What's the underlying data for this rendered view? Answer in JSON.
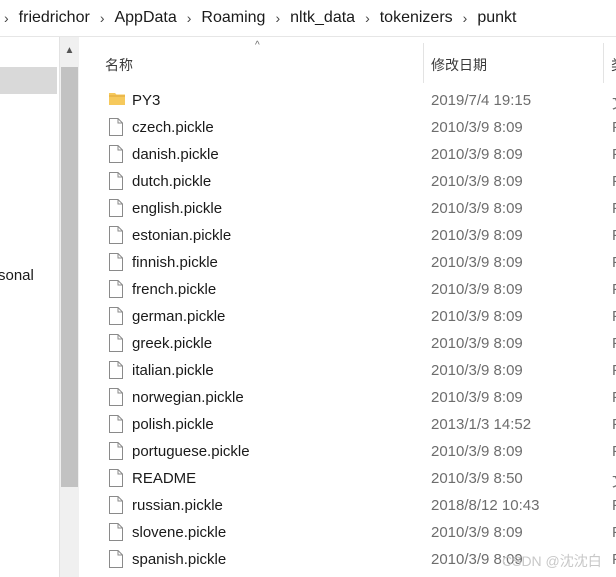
{
  "breadcrumb": {
    "items": [
      "friedrichor",
      "AppData",
      "Roaming",
      "nltk_data",
      "tokenizers",
      "punkt"
    ],
    "separator": "›"
  },
  "nav": {
    "partial_item": "sonal"
  },
  "columns": {
    "name": "名称",
    "date_modified": "修改日期",
    "type_partial": "类"
  },
  "files": [
    {
      "name": "PY3",
      "date": "2019/7/4 19:15",
      "type": "文",
      "icon": "folder-icon"
    },
    {
      "name": "czech.pickle",
      "date": "2010/3/9 8:09",
      "type": "P",
      "icon": "document-icon"
    },
    {
      "name": "danish.pickle",
      "date": "2010/3/9 8:09",
      "type": "P",
      "icon": "document-icon"
    },
    {
      "name": "dutch.pickle",
      "date": "2010/3/9 8:09",
      "type": "P",
      "icon": "document-icon"
    },
    {
      "name": "english.pickle",
      "date": "2010/3/9 8:09",
      "type": "P",
      "icon": "document-icon"
    },
    {
      "name": "estonian.pickle",
      "date": "2010/3/9 8:09",
      "type": "P",
      "icon": "document-icon"
    },
    {
      "name": "finnish.pickle",
      "date": "2010/3/9 8:09",
      "type": "P",
      "icon": "document-icon"
    },
    {
      "name": "french.pickle",
      "date": "2010/3/9 8:09",
      "type": "P",
      "icon": "document-icon"
    },
    {
      "name": "german.pickle",
      "date": "2010/3/9 8:09",
      "type": "P",
      "icon": "document-icon"
    },
    {
      "name": "greek.pickle",
      "date": "2010/3/9 8:09",
      "type": "P",
      "icon": "document-icon"
    },
    {
      "name": "italian.pickle",
      "date": "2010/3/9 8:09",
      "type": "P",
      "icon": "document-icon"
    },
    {
      "name": "norwegian.pickle",
      "date": "2010/3/9 8:09",
      "type": "P",
      "icon": "document-icon"
    },
    {
      "name": "polish.pickle",
      "date": "2013/1/3 14:52",
      "type": "P",
      "icon": "document-icon"
    },
    {
      "name": "portuguese.pickle",
      "date": "2010/3/9 8:09",
      "type": "P",
      "icon": "document-icon"
    },
    {
      "name": "README",
      "date": "2010/3/9 8:50",
      "type": "文",
      "icon": "document-icon"
    },
    {
      "name": "russian.pickle",
      "date": "2018/8/12 10:43",
      "type": "P",
      "icon": "document-icon"
    },
    {
      "name": "slovene.pickle",
      "date": "2010/3/9 8:09",
      "type": "P",
      "icon": "document-icon"
    },
    {
      "name": "spanish.pickle",
      "date": "2010/3/9 8:09",
      "type": "P",
      "icon": "document-icon"
    }
  ],
  "watermark": "CSDN @沈沈白",
  "colors": {
    "folder": "#f6c95c",
    "selection": "#d9d9d9",
    "scrollbar_thumb": "#c2c2c2"
  }
}
